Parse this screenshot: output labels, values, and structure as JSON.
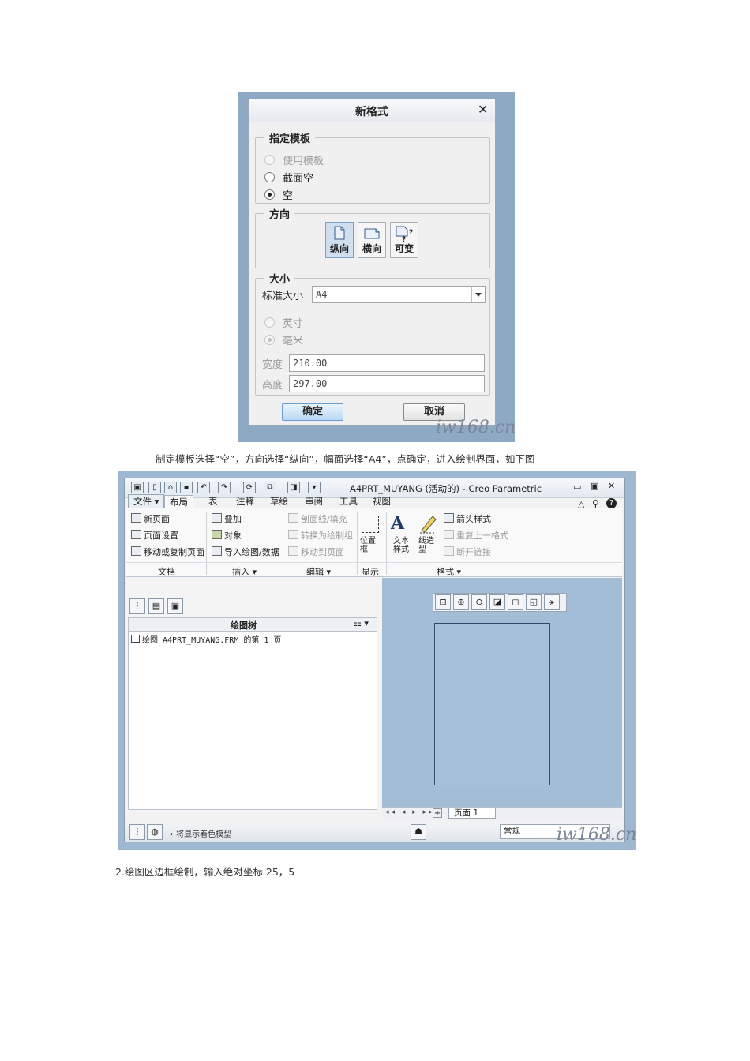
{
  "dialog": {
    "title": "新格式",
    "close_icon": "✕",
    "template_group": {
      "legend": "指定模板",
      "options": [
        "使用模板",
        "截面空",
        "空"
      ],
      "selected": "空"
    },
    "orientation_group": {
      "legend": "方向",
      "options": [
        "纵向",
        "横向",
        "可变"
      ],
      "selected": "纵向"
    },
    "size_group": {
      "legend": "大小",
      "standard_label": "标准大小",
      "standard_value": "A4",
      "units": [
        "英寸",
        "毫米"
      ],
      "unit_selected": "毫米",
      "width_label": "宽度",
      "width_value": "210.00",
      "height_label": "高度",
      "height_value": "297.00"
    },
    "ok_label": "确定",
    "cancel_label": "取消"
  },
  "watermark": "iw168.cn",
  "caption1": "制定模板选择“空”，方向选择“纵向”，幅面选择“A4”，点确定，进入绘制界面，如下图",
  "creo": {
    "window_title": "A4PRT_MUYANG (活动的) - Creo Parametric",
    "menu_file": "文件",
    "tabs": [
      "布局",
      "表",
      "注释",
      "草绘",
      "审阅",
      "工具",
      "视图"
    ],
    "active_tab": "布局",
    "ribbon": {
      "document": {
        "items": [
          "新页面",
          "页面设置",
          "移动或复制页面"
        ],
        "label": "文档"
      },
      "insert": {
        "items": [
          "叠加",
          "对象",
          "导入绘图/数据"
        ],
        "label": "插入"
      },
      "edit": {
        "items": [
          "剖面线/填充",
          "转换为绘制组",
          "移动到页面"
        ],
        "label": "编辑"
      },
      "display": {
        "items": [
          "位置框"
        ],
        "label": "显示"
      },
      "format": {
        "items": [
          "文本样式",
          "线造型",
          "箭头样式",
          "重复上一格式",
          "断开链接"
        ],
        "label": "格式"
      }
    },
    "tree": {
      "header": "绘图树",
      "item": "绘图 A4PRT_MUYANG.FRM 的第 1 页"
    },
    "page_nav": {
      "label": "页面 1"
    },
    "status": {
      "message": "将显示着色模型",
      "filter": "常规"
    },
    "colors": {
      "graphics_bg": "#a3bdd6",
      "ribbon_bg": "#f9f9f9"
    }
  },
  "caption2": "2.绘图区边框绘制，输入绝对坐标 25，5"
}
